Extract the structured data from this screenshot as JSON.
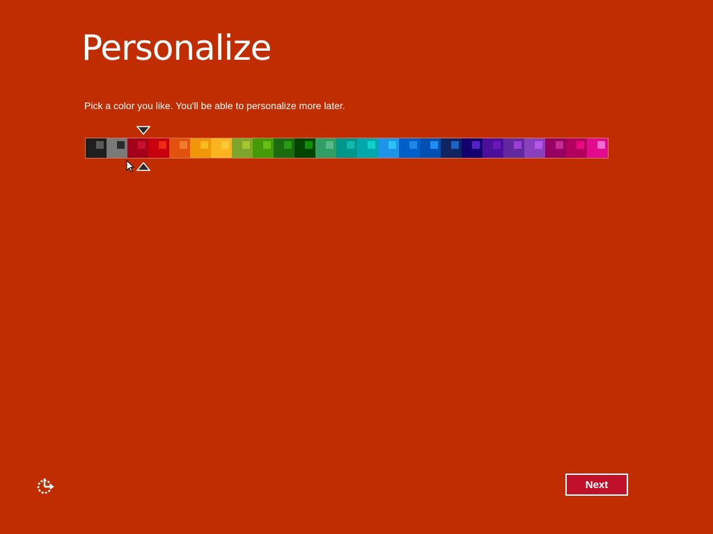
{
  "page": {
    "title": "Personalize",
    "subtitle": "Pick a color you like. You'll be able to personalize more later.",
    "background_color": "#bf2d00",
    "next_label": "Next",
    "next_button_color": "#c0102a"
  },
  "palette": {
    "selected_index": 2,
    "swatches": [
      {
        "bg": "#1f1f1f",
        "accent": "#5a5a5a"
      },
      {
        "bg": "#7a7a7a",
        "accent": "#2b2b2b"
      },
      {
        "bg": "#a3001c",
        "accent": "#c8102e"
      },
      {
        "bg": "#c8000e",
        "accent": "#ee2a16"
      },
      {
        "bg": "#e2520e",
        "accent": "#f07c31"
      },
      {
        "bg": "#f09609",
        "accent": "#f7bb1e"
      },
      {
        "bg": "#fbb31f",
        "accent": "#ffc935"
      },
      {
        "bg": "#7ea52c",
        "accent": "#a3c72c"
      },
      {
        "bg": "#459a07",
        "accent": "#67be15"
      },
      {
        "bg": "#1b6b10",
        "accent": "#279b13"
      },
      {
        "bg": "#004400",
        "accent": "#108f0a"
      },
      {
        "bg": "#2e9e62",
        "accent": "#55b98a"
      },
      {
        "bg": "#00968c",
        "accent": "#10b8ad"
      },
      {
        "bg": "#00a8ab",
        "accent": "#10d0c8"
      },
      {
        "bg": "#1e94e8",
        "accent": "#2cc1f5"
      },
      {
        "bg": "#005ec8",
        "accent": "#1b89e5"
      },
      {
        "bg": "#0050b4",
        "accent": "#1d8ef0"
      },
      {
        "bg": "#102462",
        "accent": "#1c64c4"
      },
      {
        "bg": "#13006e",
        "accent": "#5520c8"
      },
      {
        "bg": "#4d0f9b",
        "accent": "#6a18b8"
      },
      {
        "bg": "#62299e",
        "accent": "#9b3fd4"
      },
      {
        "bg": "#8a3fbd",
        "accent": "#b456e8"
      },
      {
        "bg": "#950060",
        "accent": "#c32a93"
      },
      {
        "bg": "#b1005d",
        "accent": "#e8097f"
      },
      {
        "bg": "#e20b8e",
        "accent": "#f56ad3"
      }
    ]
  },
  "icons": {
    "back": "accessibility-icon"
  }
}
